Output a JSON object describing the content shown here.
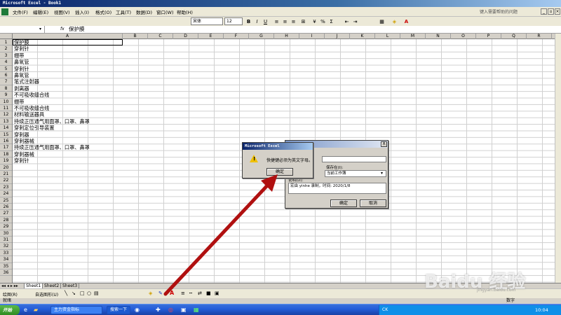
{
  "window": {
    "title": "Microsoft Excel - Book1"
  },
  "menu": {
    "items": [
      "文件(F)",
      "编辑(E)",
      "视图(V)",
      "插入(I)",
      "格式(O)",
      "工具(T)",
      "数据(D)",
      "窗口(W)",
      "帮助(H)"
    ],
    "help_placeholder": "键入需要帮助的问题"
  },
  "toolbar": {
    "font_name": "宋体",
    "font_size": "12",
    "bold": "B",
    "italic": "I",
    "underline": "U"
  },
  "formula": {
    "name_box": "",
    "fx": "fx",
    "content": "保护膜"
  },
  "sheet": {
    "columns": [
      "A",
      "B",
      "C",
      "D",
      "E",
      "F",
      "G",
      "H",
      "I",
      "J",
      "K",
      "L",
      "M",
      "N",
      "O",
      "P",
      "Q",
      "R"
    ],
    "rows": [
      "1",
      "2",
      "3",
      "4",
      "5",
      "6",
      "7",
      "8",
      "9",
      "10",
      "11",
      "12",
      "13",
      "14",
      "15",
      "16",
      "17",
      "18",
      "19",
      "20",
      "21",
      "22",
      "23",
      "24",
      "25",
      "26",
      "27",
      "28",
      "29",
      "30",
      "31",
      "32",
      "33",
      "34",
      "35",
      "36"
    ],
    "column_a": [
      "保护膜",
      "穿刺针",
      "绷带",
      "鼻氧管",
      "穿刺针",
      "鼻氧管",
      "笔式注射器",
      "剥离器",
      "不可吸收缝合线",
      "绷带",
      "不可吸收缝合线",
      "材料输送器具",
      "持续正压通气用面罩、口罩、鼻罩",
      "穿刺定位引导装置",
      "穿刺器",
      "穿刺器械",
      "持续正压通气用面罩、口罩、鼻罩",
      "穿刺器械",
      "穿刺针"
    ],
    "tabs": [
      "Sheet1",
      "Sheet2",
      "Sheet3"
    ]
  },
  "draw_toolbar": {
    "draw_label": "绘图(R)",
    "autoshape_label": "自选图形(U)"
  },
  "status": {
    "left": "就绪",
    "right": "数字"
  },
  "alert_dialog": {
    "title": "Microsoft Excel",
    "message": "快捷键必须为英文字母。",
    "ok": "确定"
  },
  "macro_dialog": {
    "store_label": "保存在(I):",
    "store_value": "当前工作簿",
    "desc_label": "说明(D):",
    "desc_value": "宏由 yinhe 录制，时间: 2020/1/8",
    "ok": "确定",
    "cancel": "取消",
    "close": "X"
  },
  "taskbar": {
    "start": "开始",
    "tasks": [
      "主力资金指标",
      "搜索一下"
    ],
    "tray_ime": "CK",
    "clock": "10:04"
  },
  "watermark": {
    "text": "Baidu 经验",
    "url": "jingyan.baidu.com"
  },
  "colors": {
    "arrow": "#b01010",
    "title_bar": "#0a246a",
    "taskbar": "#245edb",
    "start": "#2e8b22"
  }
}
